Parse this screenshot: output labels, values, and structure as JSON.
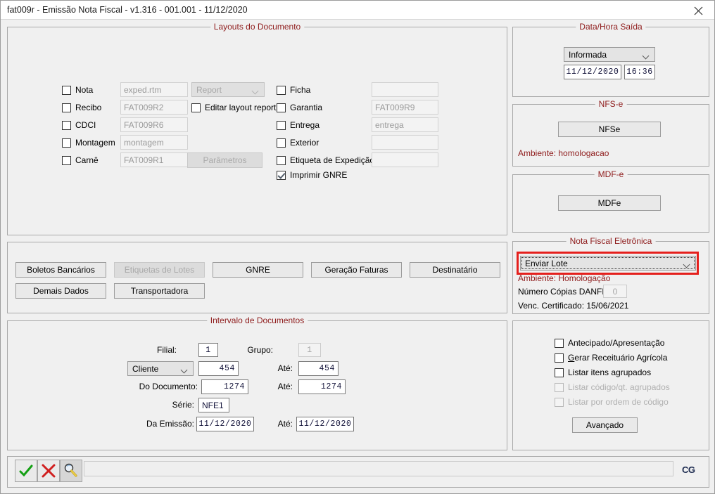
{
  "window": {
    "title": "fat009r - Emissão Nota Fiscal - v1.316 - 001.001 - 11/12/2020",
    "close_label": "close-icon"
  },
  "layouts_group": {
    "title": "Layouts do Documento",
    "left_checkboxes": [
      {
        "label": "Nota",
        "checked": false,
        "value": "exped.rtm"
      },
      {
        "label": "Recibo",
        "checked": false,
        "value": "FAT009R2"
      },
      {
        "label": "CDCI",
        "checked": false,
        "value": "FAT009R6"
      },
      {
        "label": "Montagem",
        "checked": false,
        "value": "montagem"
      },
      {
        "label": "Carnê",
        "checked": false,
        "value": "FAT009R1"
      }
    ],
    "report_combo": {
      "value": "Report",
      "disabled": true
    },
    "editar_layout": {
      "label": "Editar layout report",
      "checked": false
    },
    "parametros_button": {
      "label": "Parâmetros",
      "disabled": true
    },
    "right_checkboxes": [
      {
        "label": "Ficha",
        "checked": false,
        "value": ""
      },
      {
        "label": "Garantia",
        "checked": false,
        "value": "FAT009R9"
      },
      {
        "label": "Entrega",
        "checked": false,
        "value": "entrega"
      },
      {
        "label": "Exterior",
        "checked": false,
        "value": ""
      },
      {
        "label": "Etiqueta de Expedição",
        "checked": false,
        "value": ""
      }
    ],
    "imprimir_gnre": {
      "label": "Imprimir GNRE",
      "checked": true
    }
  },
  "datahora_group": {
    "title": "Data/Hora Saída",
    "mode": "Informada",
    "date": "11/12/2020",
    "time": "16:36"
  },
  "nfse_group": {
    "title": "NFS-e",
    "button_label": "NFSe",
    "ambiente": "Ambiente: homologacao"
  },
  "mdfe_group": {
    "title": "MDF-e",
    "button_label": "MDFe"
  },
  "nfe_group": {
    "title": "Nota Fiscal Eletrônica",
    "action_combo": "Enviar Lote",
    "ambiente": "Ambiente: Homologação",
    "copias_label": "Número Cópias DANFE:",
    "copias_value": "0",
    "venc_certificado": "Venc. Certificado: 15/06/2021",
    "highlight_color": "#e5201d"
  },
  "action_buttons": [
    {
      "label": "Boletos Bancários",
      "disabled": false
    },
    {
      "label": "Etiquetas de Lotes",
      "disabled": true
    },
    {
      "label": "GNRE",
      "disabled": false
    },
    {
      "label": "Geração Faturas",
      "disabled": false
    },
    {
      "label": "Destinatário",
      "disabled": false
    },
    {
      "label": "Demais Dados",
      "disabled": false
    },
    {
      "label": "Transportadora",
      "disabled": false
    }
  ],
  "intervalo_group": {
    "title": "Intervalo de Documentos",
    "filial_label": "Filial:",
    "filial_value": "1",
    "grupo_label": "Grupo:",
    "grupo_value": "1",
    "tipo_combo": "Cliente",
    "tipo_value": "454",
    "tipo_ate_label": "Até:",
    "tipo_ate_value": "454",
    "documento_label": "Do Documento:",
    "documento_value": "1274",
    "documento_ate_label": "Até:",
    "documento_ate_value": "1274",
    "serie_label": "Série:",
    "serie_value": "NFE1",
    "emissao_label": "Da Emissão:",
    "emissao_value": "11/12/2020",
    "emissao_ate_label": "Até:",
    "emissao_ate_value": "11/12/2020"
  },
  "options_panel": {
    "checkboxes": [
      {
        "label": "Antecipado/Apresentação",
        "checked": false,
        "disabled": false,
        "accel": ""
      },
      {
        "label": "erar Receituário Agrícola",
        "checked": false,
        "disabled": false,
        "accel": "G"
      },
      {
        "label": "Listar itens agrupados",
        "checked": false,
        "disabled": false,
        "accel": ""
      },
      {
        "label": "Listar código/qt. agrupados",
        "checked": false,
        "disabled": true,
        "accel": ""
      },
      {
        "label": "Listar por ordem de código",
        "checked": false,
        "disabled": true,
        "accel": ""
      }
    ],
    "avancado_button": "Avançado"
  },
  "bottom_toolbar": {
    "confirm_icon": "check-icon",
    "cancel_icon": "x-icon",
    "search_icon": "magnifier-icon",
    "status_value": "",
    "logo": "CG"
  }
}
